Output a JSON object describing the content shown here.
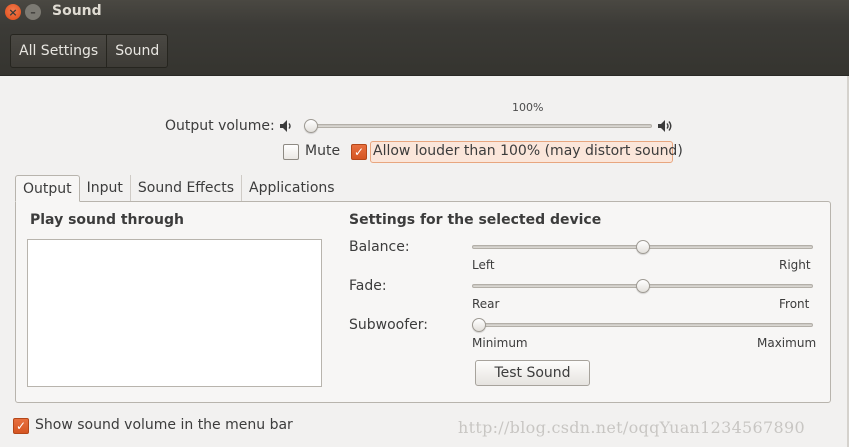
{
  "window": {
    "title": "Sound",
    "close_glyph": "×",
    "minimize_glyph": "–"
  },
  "toolbar": {
    "crumbs": [
      "All Settings",
      "Sound"
    ]
  },
  "output_volume": {
    "label": "Output volume:",
    "percent_label": "100%",
    "level": 0.0,
    "icon_low": "speaker-low-icon",
    "icon_high": "speaker-high-icon"
  },
  "mute": {
    "label": "Mute",
    "checked": false
  },
  "allow_louder": {
    "label": "Allow louder than 100% (may distort sound)",
    "checked": true
  },
  "tabs": [
    {
      "label": "Output",
      "active": true
    },
    {
      "label": "Input",
      "active": false
    },
    {
      "label": "Sound Effects",
      "active": false
    },
    {
      "label": "Applications",
      "active": false
    }
  ],
  "left_panel": {
    "title": "Play sound through",
    "devices": []
  },
  "right_panel": {
    "title": "Settings for the selected device",
    "balance": {
      "label": "Balance:",
      "min_label": "Left",
      "max_label": "Right",
      "level": 0.5
    },
    "fade": {
      "label": "Fade:",
      "min_label": "Rear",
      "max_label": "Front",
      "level": 0.5
    },
    "subwoofer": {
      "label": "Subwoofer:",
      "min_label": "Minimum",
      "max_label": "Maximum",
      "level": 0.0
    },
    "test_button": "Test Sound"
  },
  "menubar_option": {
    "label": "Show sound volume in the menu bar",
    "checked": true
  },
  "watermark": "http://blog.csdn.net/oqqYuan1234567890",
  "colors": {
    "accent": "#e9632f",
    "titlebar": "#3c3b37",
    "background": "#f2f1f0"
  }
}
